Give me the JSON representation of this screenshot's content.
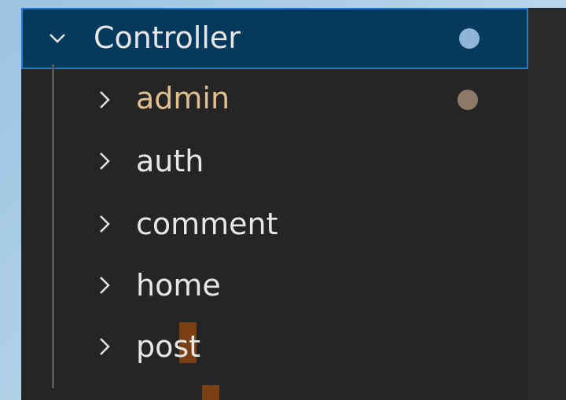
{
  "explorer": {
    "root": {
      "label": "Controller",
      "expanded": true,
      "chevron_icon": "chevron-down-icon",
      "decoration_color": "#8fb6d6"
    },
    "children": [
      {
        "label": "admin",
        "chevron_icon": "chevron-right-icon",
        "modified": true,
        "decoration_color": "#8b7b68"
      },
      {
        "label": "auth",
        "chevron_icon": "chevron-right-icon",
        "modified": false
      },
      {
        "label": "comment",
        "chevron_icon": "chevron-right-icon",
        "modified": false
      },
      {
        "label": "home",
        "chevron_icon": "chevron-right-icon",
        "modified": false
      },
      {
        "label": "post",
        "chevron_icon": "chevron-right-icon",
        "modified": false
      }
    ]
  },
  "colors": {
    "panel_background": "#252526",
    "selection_background": "#04395e",
    "selection_border": "#1e7bd3",
    "modified_text": "#e2c08d",
    "text": "#e7e7e7"
  }
}
